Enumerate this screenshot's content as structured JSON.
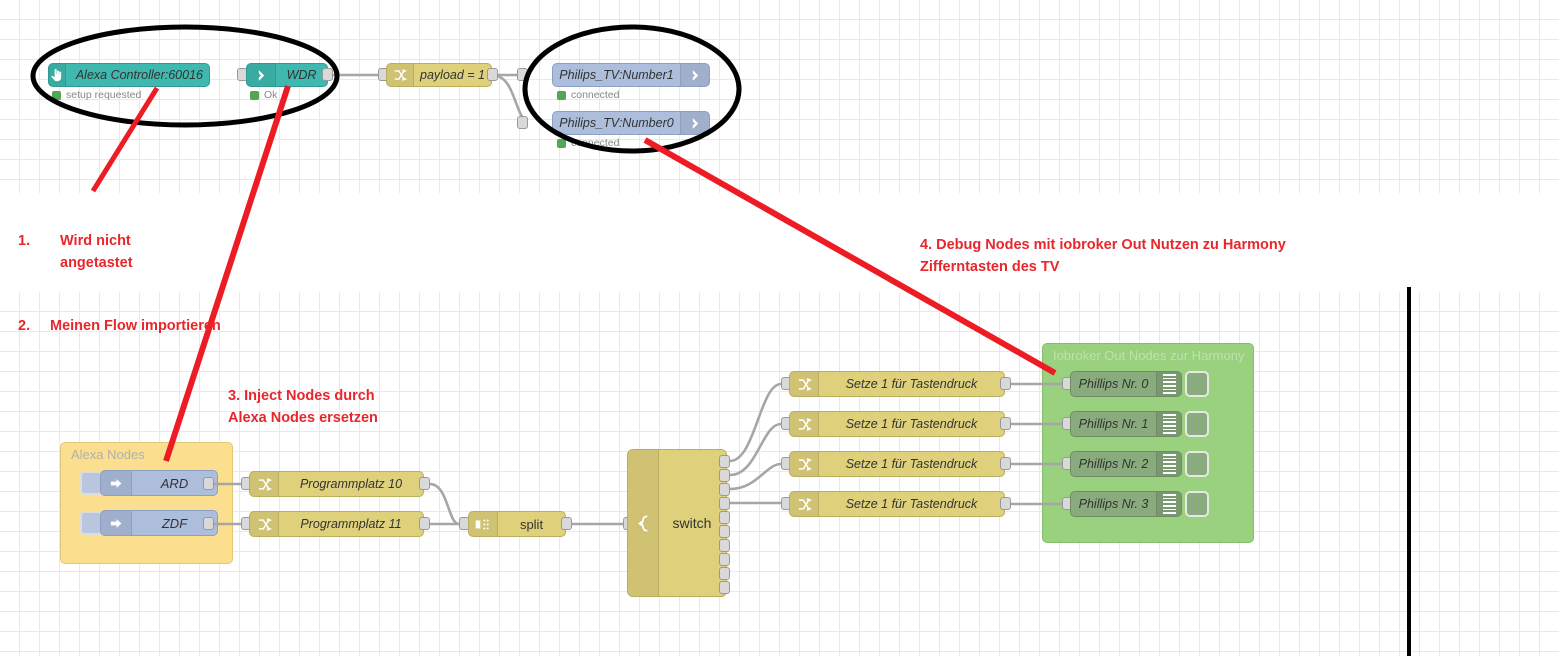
{
  "app": {
    "name": "Node-RED flow editor screenshot with annotations"
  },
  "top_flow": {
    "nodes": [
      {
        "id": "alexa-controller",
        "label": "Alexa Controller:60016",
        "status": "setup requested",
        "icon": "hand-cursor-icon",
        "color": "#3fb8af"
      },
      {
        "id": "wdr",
        "label": "WDR",
        "status": "Ok",
        "icon": "alexa-arrow-icon",
        "color": "#3fb8af"
      },
      {
        "id": "payload-switch",
        "label": "payload = 1",
        "icon": "switch-icon",
        "color": "#dfd17b"
      },
      {
        "id": "philips-number1",
        "label": "Philips_TV:Number1",
        "status": "connected",
        "icon": "arrow-right-icon",
        "color": "#adbedc"
      },
      {
        "id": "philips-number0",
        "label": "Philips_TV:Number0",
        "status": "connected",
        "icon": "arrow-right-icon",
        "color": "#adbedc"
      }
    ]
  },
  "bottom_flow": {
    "alexa_group": {
      "title": "Alexa Nodes",
      "color": "#fbdf8e",
      "inject_nodes": [
        {
          "label": "ARD",
          "icon": "inject-arrow-icon"
        },
        {
          "label": "ZDF",
          "icon": "inject-arrow-icon"
        }
      ]
    },
    "change_nodes": [
      {
        "label": "Programmplatz 10",
        "icon": "change-icon"
      },
      {
        "label": "Programmplatz 11",
        "icon": "change-icon"
      }
    ],
    "split_node": {
      "label": "split",
      "icon": "split-icon"
    },
    "switch_node": {
      "label": "switch",
      "icon": "switch-branch-icon",
      "output_count": 10,
      "connected_outputs": 4
    },
    "setze_nodes": [
      {
        "label": "Setze 1 für Tastendruck",
        "icon": "change-icon"
      },
      {
        "label": "Setze 1 für Tastendruck",
        "icon": "change-icon"
      },
      {
        "label": "Setze 1 für Tastendruck",
        "icon": "change-icon"
      },
      {
        "label": "Setze 1 für Tastendruck",
        "icon": "change-icon"
      }
    ],
    "iobroker_group": {
      "title": "Iobroker Out Nodes zur Harmony",
      "color": "#9ad17f",
      "debug_nodes": [
        {
          "label": "Phillips Nr. 0",
          "icon": "debug-bars-icon"
        },
        {
          "label": "Phillips Nr. 1",
          "icon": "debug-bars-icon"
        },
        {
          "label": "Phillips Nr. 2",
          "icon": "debug-bars-icon"
        },
        {
          "label": "Phillips Nr. 3",
          "icon": "debug-bars-icon"
        }
      ]
    }
  },
  "annotations": {
    "color": "#e8262c",
    "items": [
      {
        "id": "a1",
        "number": "1.",
        "text": "Wird nicht\nangetastet"
      },
      {
        "id": "a2",
        "number": "2.",
        "text": "Meinen Flow importieren"
      },
      {
        "id": "a3",
        "number": "",
        "text": "3. Inject Nodes durch\nAlexa Nodes ersetzen"
      },
      {
        "id": "a4",
        "number": "",
        "text": "4. Debug Nodes mit iobroker Out Nutzen zu Harmony\nZifferntasten des TV"
      }
    ]
  }
}
